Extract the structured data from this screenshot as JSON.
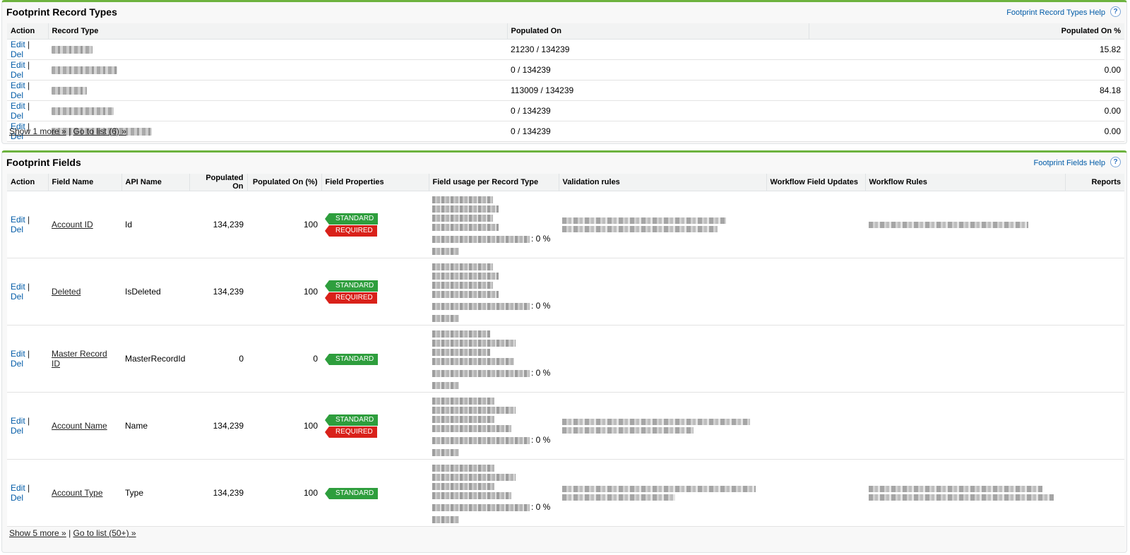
{
  "record_types_panel": {
    "title": "Footprint Record Types",
    "help_link": "Footprint Record Types Help",
    "columns": [
      "Action",
      "Record Type",
      "Populated On",
      "Populated On %"
    ],
    "rows": [
      {
        "edit": "Edit",
        "sep": "|",
        "del": "Del",
        "populated_on": "21230 / 134239",
        "populated_pct": "15.82"
      },
      {
        "edit": "Edit",
        "sep": "|",
        "del": "Del",
        "populated_on": "0 / 134239",
        "populated_pct": "0.00"
      },
      {
        "edit": "Edit",
        "sep": "|",
        "del": "Del",
        "populated_on": "113009 / 134239",
        "populated_pct": "84.18"
      },
      {
        "edit": "Edit",
        "sep": "|",
        "del": "Del",
        "populated_on": "0 / 134239",
        "populated_pct": "0.00"
      },
      {
        "edit": "Edit",
        "sep": "|",
        "del": "Del",
        "populated_on": "0 / 134239",
        "populated_pct": "0.00"
      }
    ],
    "footer": {
      "show_more": "Show 1 more »",
      "sep": "|",
      "go_to_list": "Go to list (6) »"
    }
  },
  "fields_panel": {
    "title": "Footprint Fields",
    "help_link": "Footprint Fields Help",
    "columns": [
      "Action",
      "Field Name",
      "API Name",
      "Populated On",
      "Populated On (%)",
      "Field Properties",
      "Field usage per Record Type",
      "Validation rules",
      "Workflow Field Updates",
      "Workflow Rules",
      "Reports"
    ],
    "badge_standard": "STANDARD",
    "badge_required": "REQUIRED",
    "usage_tail": ": 0 %",
    "rows": [
      {
        "edit": "Edit",
        "sep": "|",
        "del": "Del",
        "field_name": "Account ID",
        "api_name": "Id",
        "populated_on": "134,239",
        "populated_pct": "100"
      },
      {
        "edit": "Edit",
        "sep": "|",
        "del": "Del",
        "field_name": "Deleted",
        "api_name": "IsDeleted",
        "populated_on": "134,239",
        "populated_pct": "100"
      },
      {
        "edit": "Edit",
        "sep": "|",
        "del": "Del",
        "field_name": "Master Record ID",
        "api_name": "MasterRecordId",
        "populated_on": "0",
        "populated_pct": "0"
      },
      {
        "edit": "Edit",
        "sep": "|",
        "del": "Del",
        "field_name": "Account Name",
        "api_name": "Name",
        "populated_on": "134,239",
        "populated_pct": "100"
      },
      {
        "edit": "Edit",
        "sep": "|",
        "del": "Del",
        "field_name": "Account Type",
        "api_name": "Type",
        "populated_on": "134,239",
        "populated_pct": "100"
      }
    ],
    "footer": {
      "show_more": "Show 5 more »",
      "sep": "|",
      "go_to_list": "Go to list (50+) »"
    }
  },
  "colors": {
    "accent_green": "#6db33f",
    "link_blue": "#015ba7",
    "standard_badge": "#2e9e3d",
    "required_badge": "#d9211a"
  },
  "icons": {
    "help": "question-circle-icon"
  }
}
